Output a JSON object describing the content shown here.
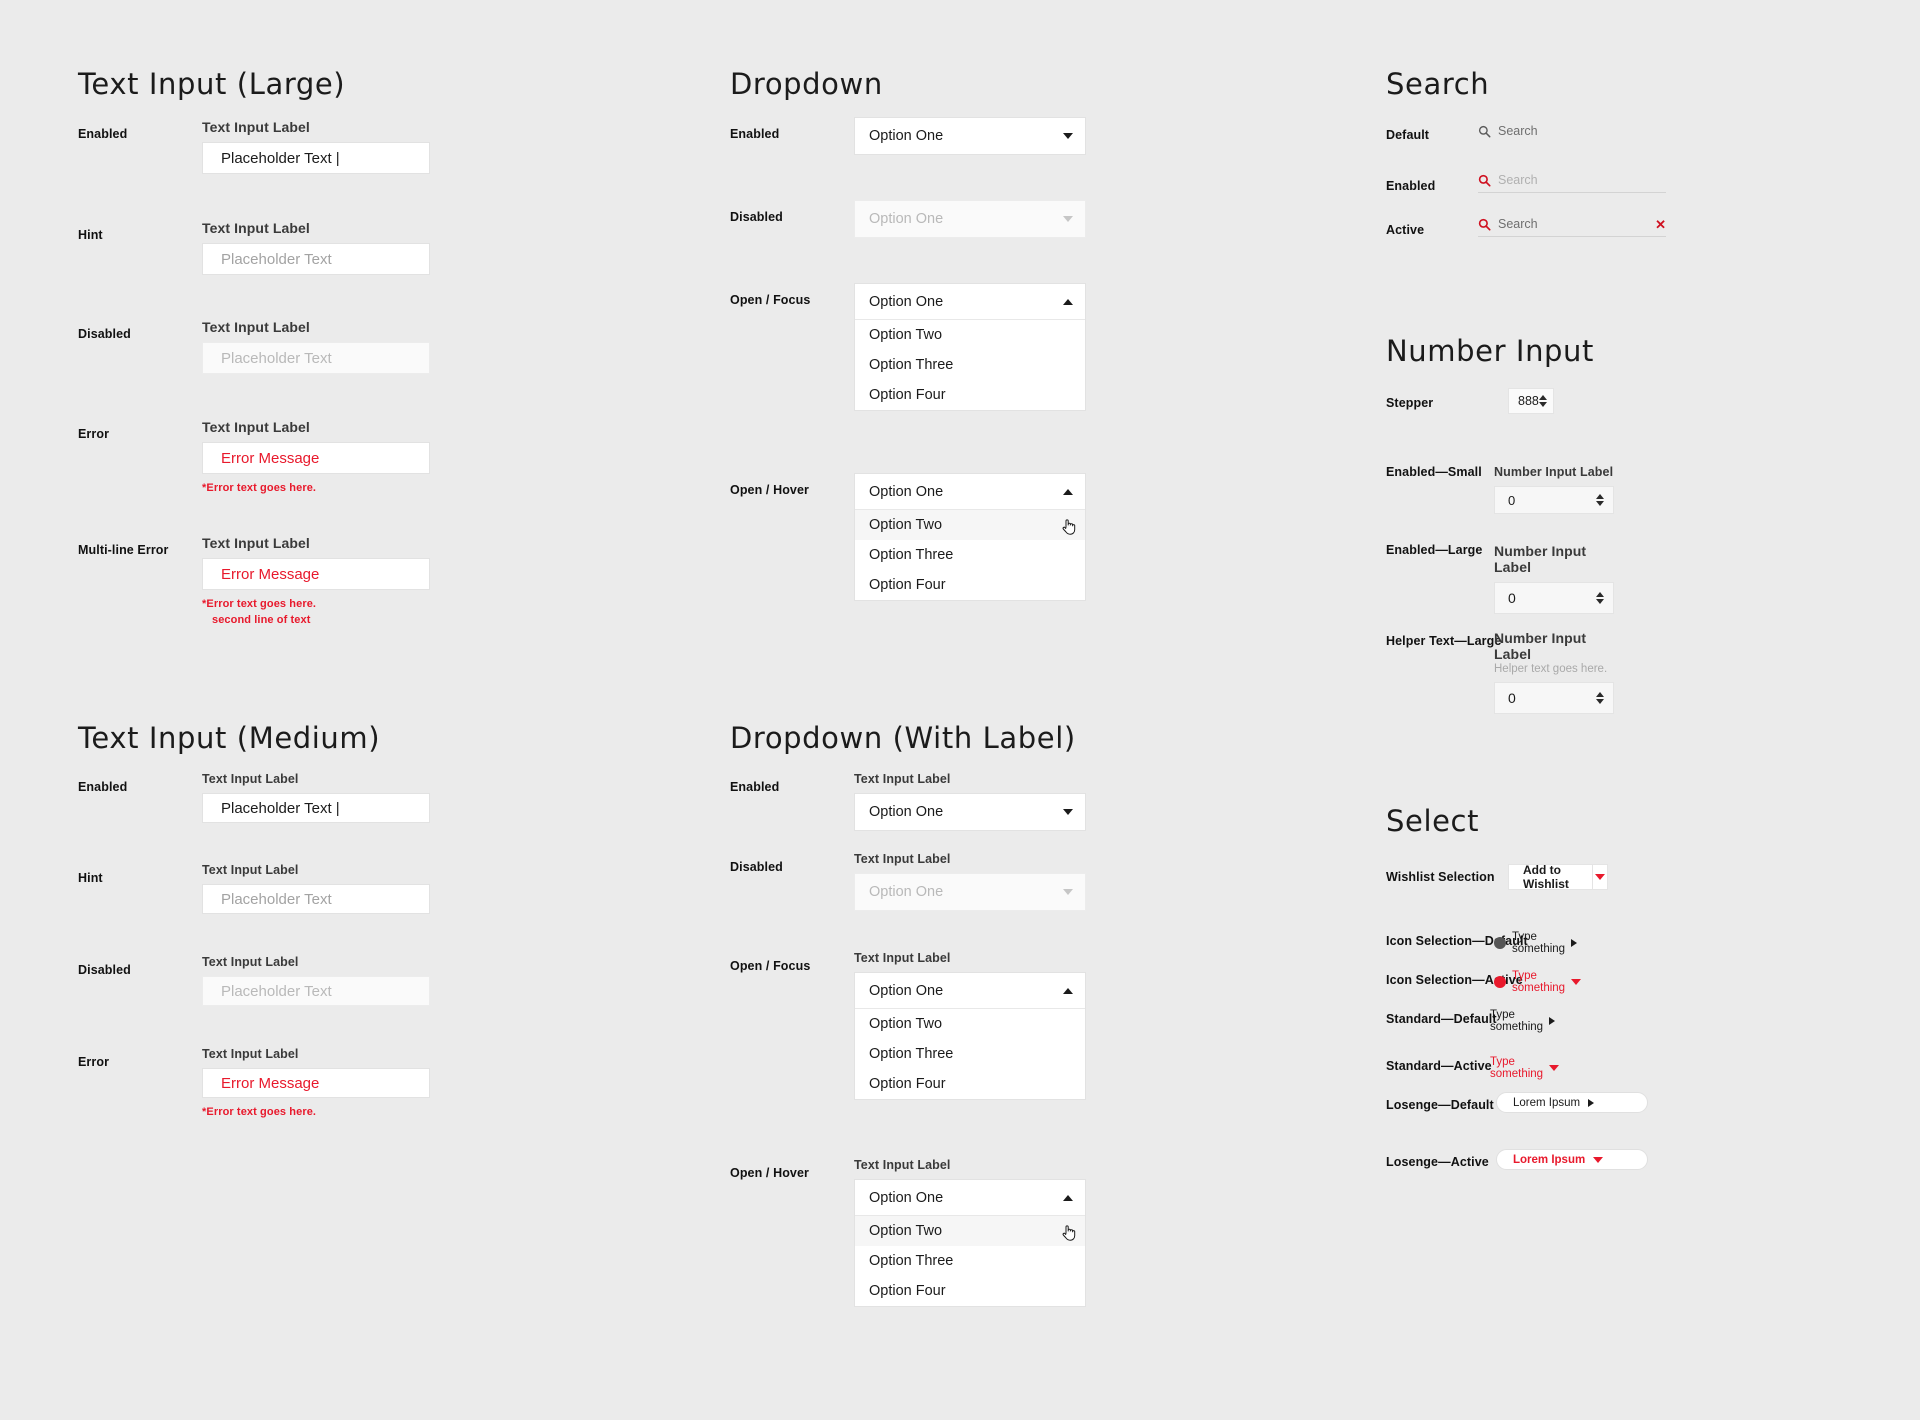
{
  "sections": {
    "text_input_large": {
      "title": "Text Input (Large)",
      "rows": [
        {
          "state": "Enabled",
          "label": "Text Input Label",
          "value": "Placeholder Text |"
        },
        {
          "state": "Hint",
          "label": "Text Input Label",
          "value": "Placeholder Text"
        },
        {
          "state": "Disabled",
          "label": "Text Input Label",
          "value": "Placeholder Text"
        },
        {
          "state": "Error",
          "label": "Text Input Label",
          "value": "Error Message",
          "error": "*Error text goes here."
        },
        {
          "state": "Multi-line Error",
          "label": "Text Input Label",
          "value": "Error Message",
          "error": "*Error text goes here.",
          "error2": "second line of text"
        }
      ]
    },
    "text_input_medium": {
      "title": "Text Input (Medium)",
      "rows": [
        {
          "state": "Enabled",
          "label": "Text Input Label",
          "value": "Placeholder Text |"
        },
        {
          "state": "Hint",
          "label": "Text Input Label",
          "value": "Placeholder Text"
        },
        {
          "state": "Disabled",
          "label": "Text Input Label",
          "value": "Placeholder Text"
        },
        {
          "state": "Error",
          "label": "Text Input Label",
          "value": "Error Message",
          "error": "*Error text goes here."
        }
      ]
    },
    "dropdown": {
      "title": "Dropdown",
      "rows": [
        {
          "state": "Enabled",
          "selected": "Option One"
        },
        {
          "state": "Disabled",
          "selected": "Option One"
        },
        {
          "state": "Open / Focus",
          "selected": "Option One",
          "options": [
            "Option Two",
            "Option Three",
            "Option Four"
          ]
        },
        {
          "state": "Open / Hover",
          "selected": "Option One",
          "options": [
            "Option Two",
            "Option Three",
            "Option Four"
          ],
          "hover_index": 0
        }
      ]
    },
    "dropdown_with_label": {
      "title": "Dropdown (With Label)",
      "rows": [
        {
          "state": "Enabled",
          "label": "Text Input Label",
          "selected": "Option One"
        },
        {
          "state": "Disabled",
          "label": "Text Input Label",
          "selected": "Option One"
        },
        {
          "state": "Open / Focus",
          "label": "Text Input Label",
          "selected": "Option One",
          "options": [
            "Option Two",
            "Option Three",
            "Option Four"
          ]
        },
        {
          "state": "Open / Hover",
          "label": "Text Input Label",
          "selected": "Option One",
          "options": [
            "Option Two",
            "Option Three",
            "Option Four"
          ],
          "hover_index": 0
        }
      ]
    },
    "search": {
      "title": "Search",
      "rows": [
        {
          "state": "Default",
          "text": "Search"
        },
        {
          "state": "Enabled",
          "text": "Search"
        },
        {
          "state": "Active",
          "text": "Search",
          "clear": "✕"
        }
      ]
    },
    "number_input": {
      "title": "Number Input",
      "rows": [
        {
          "state": "Stepper",
          "value": "888"
        },
        {
          "state": "Enabled—Small",
          "label": "Number Input Label",
          "value": "0"
        },
        {
          "state": "Enabled—Large",
          "label": "Number Input Label",
          "value": "0"
        },
        {
          "state": "Helper Text—Large",
          "label": "Number Input Label",
          "helper": "Helper text goes here.",
          "value": "0"
        }
      ]
    },
    "select": {
      "title": "Select",
      "rows": [
        {
          "state": "Wishlist Selection",
          "value": "Add to Wishlist",
          "variant": "wishlist"
        },
        {
          "state": "Icon Selection—Default",
          "value": "Type something",
          "variant": "icon-default"
        },
        {
          "state": "Icon Selection—Active",
          "value": "Type something",
          "variant": "icon-active"
        },
        {
          "state": "Standard—Default",
          "value": "Type something",
          "variant": "standard-default"
        },
        {
          "state": "Standard—Active",
          "value": "Type something",
          "variant": "standard-active"
        },
        {
          "state": "Losenge—Default",
          "value": "Lorem Ipsum",
          "variant": "losenge-default"
        },
        {
          "state": "Losenge—Active",
          "value": "Lorem Ipsum",
          "variant": "losenge-active"
        }
      ]
    }
  },
  "colors": {
    "error_red": "#e8192c",
    "background": "#ebebeb",
    "surface": "#ffffff",
    "text": "#1b1b1b"
  }
}
